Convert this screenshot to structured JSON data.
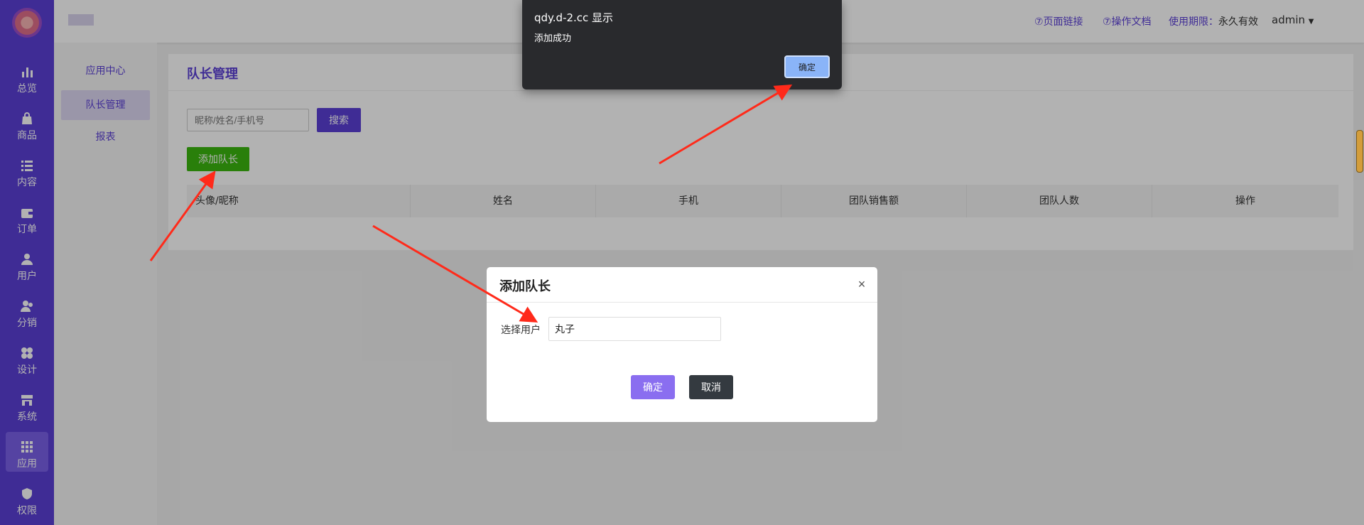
{
  "nav": {
    "items": [
      {
        "label": "总览",
        "icon": "bar-chart-icon"
      },
      {
        "label": "商品",
        "icon": "shopping-bag-icon"
      },
      {
        "label": "内容",
        "icon": "list-icon"
      },
      {
        "label": "订单",
        "icon": "wallet-icon"
      },
      {
        "label": "用户",
        "icon": "user-icon"
      },
      {
        "label": "分销",
        "icon": "users-icon"
      },
      {
        "label": "设计",
        "icon": "palette-icon"
      },
      {
        "label": "系统",
        "icon": "store-icon"
      },
      {
        "label": "应用",
        "icon": "grid-icon"
      },
      {
        "label": "权限",
        "icon": "shield-icon"
      }
    ],
    "active": "应用"
  },
  "header": {
    "page_link": "⑦页面链接",
    "docs_link": "⑦操作文档",
    "usage_label": "使用期限：",
    "usage_value": "永久有效",
    "user": "admin"
  },
  "subnav": {
    "items": [
      "应用中心",
      "队长管理",
      "报表"
    ],
    "active": "队长管理"
  },
  "main": {
    "title": "队长管理",
    "search_placeholder": "昵称/姓名/手机号",
    "search_button": "搜索",
    "add_button": "添加队长",
    "columns": [
      "头像/昵称",
      "姓名",
      "手机",
      "团队销售额",
      "团队人数",
      "操作"
    ]
  },
  "modal": {
    "title": "添加队长",
    "close": "×",
    "field_label": "选择用户",
    "field_value": "丸子",
    "ok_button": "确定",
    "cancel_button": "取消"
  },
  "alert": {
    "title": "qdy.d-2.cc 显示",
    "message": "添加成功",
    "ok_button": "确定"
  },
  "colors": {
    "brand": "#5b3fd6",
    "success": "#3bb60f",
    "annotation": "#ff2a1a"
  }
}
